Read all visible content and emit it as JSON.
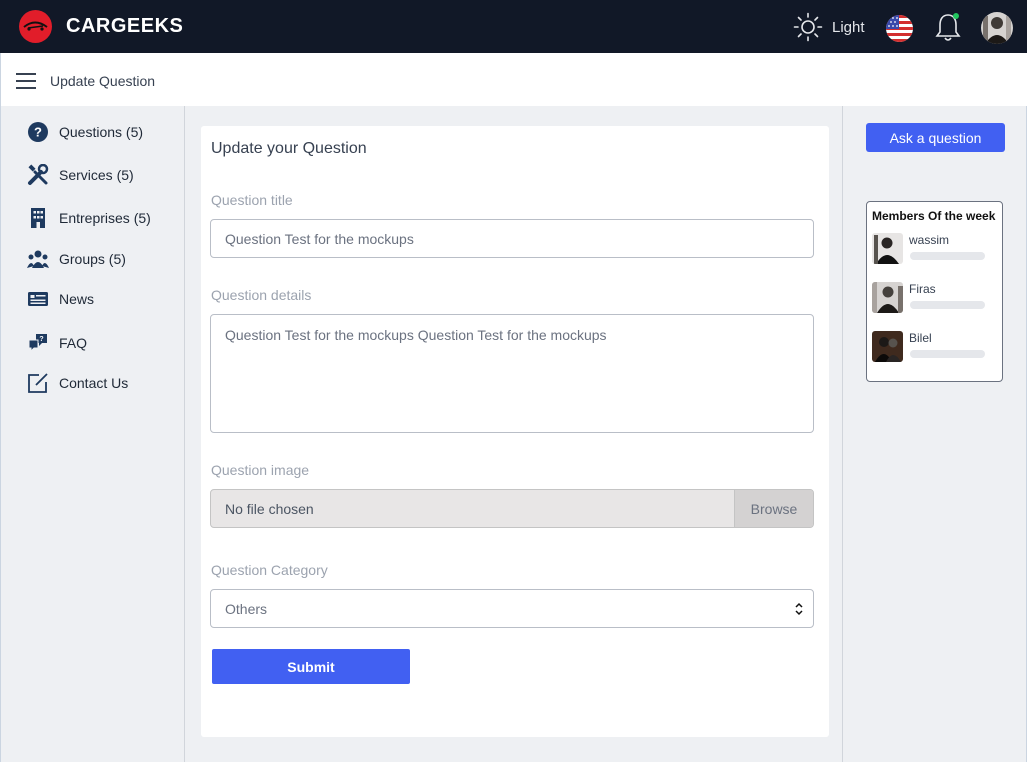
{
  "header": {
    "brand": "CARGEEKS",
    "theme_label": "Light"
  },
  "subheader": {
    "title": "Update Question"
  },
  "sidebar": {
    "items": [
      {
        "label": "Questions (5)",
        "icon": "question-icon"
      },
      {
        "label": "Services (5)",
        "icon": "tools-icon"
      },
      {
        "label": "Entreprises (5)",
        "icon": "building-icon"
      },
      {
        "label": "Groups (5)",
        "icon": "users-icon"
      },
      {
        "label": "News",
        "icon": "newspaper-icon"
      },
      {
        "label": "FAQ",
        "icon": "chat-icon"
      },
      {
        "label": "Contact Us",
        "icon": "edit-icon"
      }
    ]
  },
  "form": {
    "title": "Update your Question",
    "title_label": "Question title",
    "title_value": "Question Test for the mockups",
    "details_label": "Question details",
    "details_value": "Question Test for the mockups Question Test for the mockups",
    "image_label": "Question image",
    "image_value": "No file chosen",
    "browse_label": "Browse",
    "category_label": "Question Category",
    "category_value": "Others",
    "submit_label": "Submit"
  },
  "right": {
    "ask_label": "Ask a question",
    "members_title": "Members Of the week",
    "members": [
      {
        "name": "wassim"
      },
      {
        "name": "Firas"
      },
      {
        "name": "Bilel"
      }
    ]
  },
  "colors": {
    "topbar": "#111827",
    "accent": "#4160f2",
    "logo": "#e11d2a"
  }
}
